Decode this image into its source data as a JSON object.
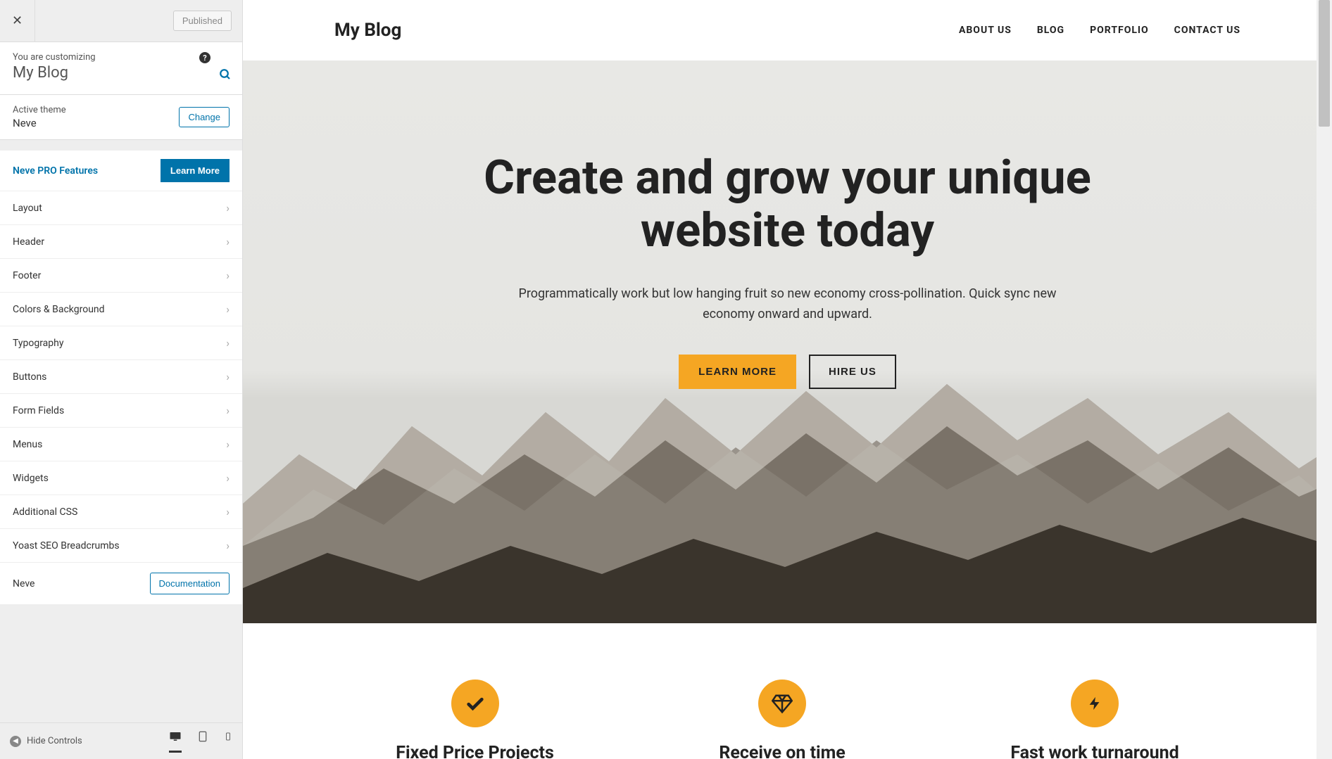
{
  "sidebar": {
    "published_label": "Published",
    "customizing_label": "You are customizing",
    "site_name": "My Blog",
    "active_theme_label": "Active theme",
    "theme_name": "Neve",
    "change_label": "Change",
    "pro_label": "Neve PRO Features",
    "learn_more_label": "Learn More",
    "menu": [
      "Layout",
      "Header",
      "Footer",
      "Colors & Background",
      "Typography",
      "Buttons",
      "Form Fields",
      "Menus",
      "Widgets",
      "Additional CSS",
      "Yoast SEO Breadcrumbs"
    ],
    "doc_name": "Neve",
    "doc_btn": "Documentation",
    "hide_controls": "Hide Controls"
  },
  "preview": {
    "site_title": "My Blog",
    "nav": [
      "ABOUT US",
      "BLOG",
      "PORTFOLIO",
      "CONTACT US"
    ],
    "hero_title": "Create and grow your unique website today",
    "hero_sub": "Programmatically work but low hanging fruit so new economy cross-pollination. Quick sync new economy onward and upward.",
    "btn_primary": "LEARN MORE",
    "btn_outline": "HIRE US",
    "features": [
      {
        "icon": "✔",
        "title": "Fixed Price Projects"
      },
      {
        "icon": "◈",
        "title": "Receive on time"
      },
      {
        "icon": "⚡",
        "title": "Fast work turnaround"
      }
    ]
  }
}
